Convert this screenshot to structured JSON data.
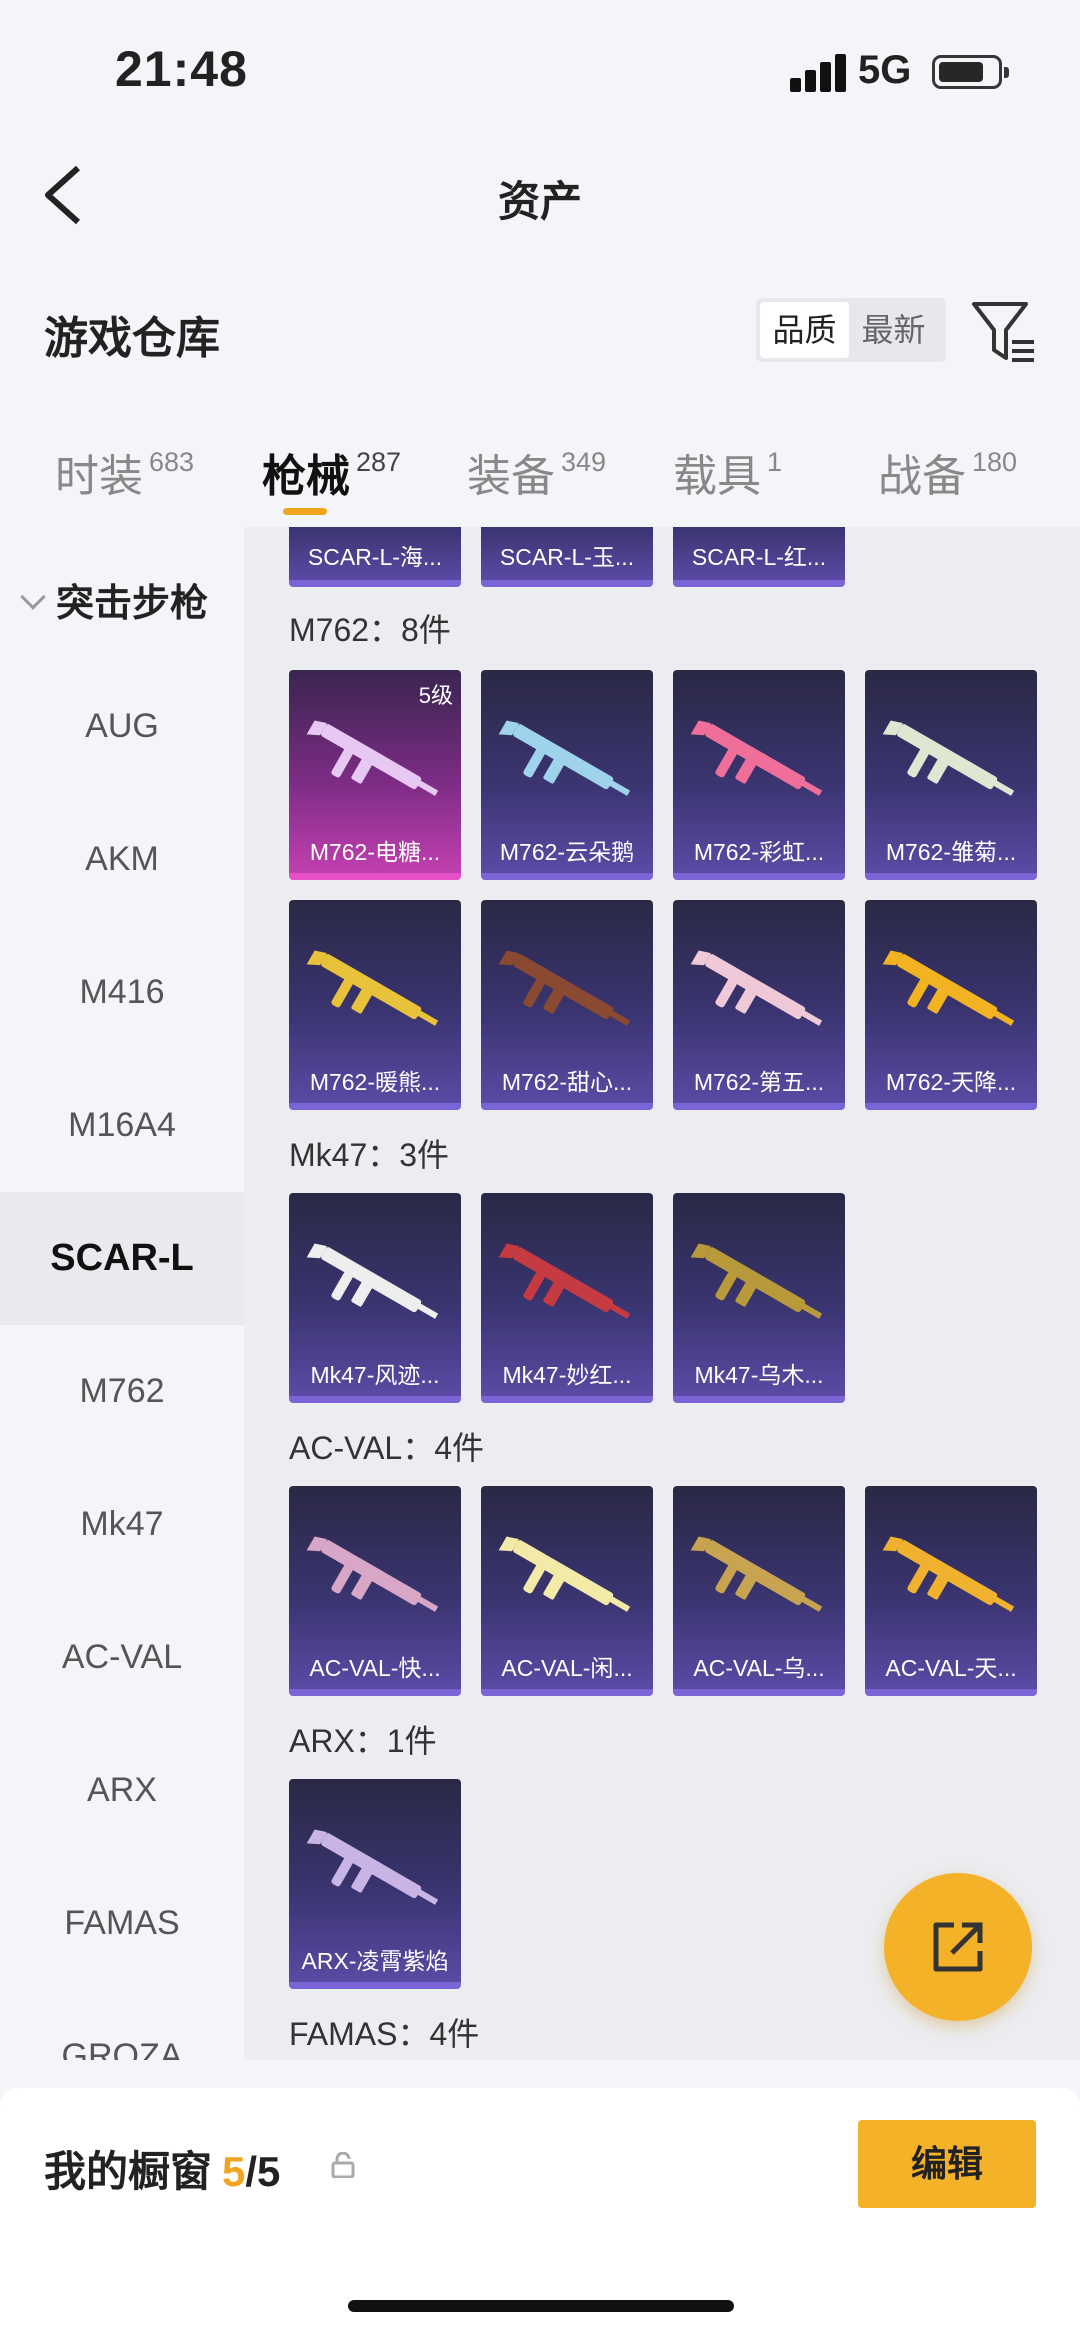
{
  "status": {
    "time": "21:48",
    "network": "5G"
  },
  "nav": {
    "title": "资产"
  },
  "section": {
    "title": "游戏仓库",
    "sort_options": [
      "品质",
      "最新"
    ]
  },
  "tabs": [
    {
      "label": "时装",
      "count": "683"
    },
    {
      "label": "枪械",
      "count": "287"
    },
    {
      "label": "装备",
      "count": "349"
    },
    {
      "label": "载具",
      "count": "1"
    },
    {
      "label": "战备",
      "count": "180"
    }
  ],
  "sidebar": {
    "category": "突击步枪",
    "items": [
      "AUG",
      "AKM",
      "M416",
      "M16A4",
      "SCAR-L",
      "M762",
      "Mk47",
      "AC-VAL",
      "ARX",
      "FAMAS",
      "GROZA"
    ],
    "selected": "SCAR-L"
  },
  "content": {
    "top_cut": [
      "SCAR-L-海...",
      "SCAR-L-玉...",
      "SCAR-L-红..."
    ],
    "groups": [
      {
        "title": "M762：8件",
        "items": [
          "M762-电糖...",
          "M762-云朵鹅",
          "M762-彩虹...",
          "M762-雏菊...",
          "M762-暖熊...",
          "M762-甜心...",
          "M762-第五...",
          "M762-天降..."
        ]
      },
      {
        "title": "Mk47：3件",
        "items": [
          "Mk47-风迹...",
          "Mk47-妙红...",
          "Mk47-乌木..."
        ]
      },
      {
        "title": "AC-VAL：4件",
        "items": [
          "AC-VAL-快...",
          "AC-VAL-闲...",
          "AC-VAL-乌...",
          "AC-VAL-天..."
        ]
      },
      {
        "title": "ARX：1件",
        "items": [
          "ARX-凌霄紫焰"
        ]
      },
      {
        "title": "FAMAS：4件",
        "items": []
      }
    ],
    "first_card_level": "5级"
  },
  "bottom": {
    "title": "我的橱窗",
    "count": "5",
    "total": "/5",
    "edit_label": "编辑"
  }
}
